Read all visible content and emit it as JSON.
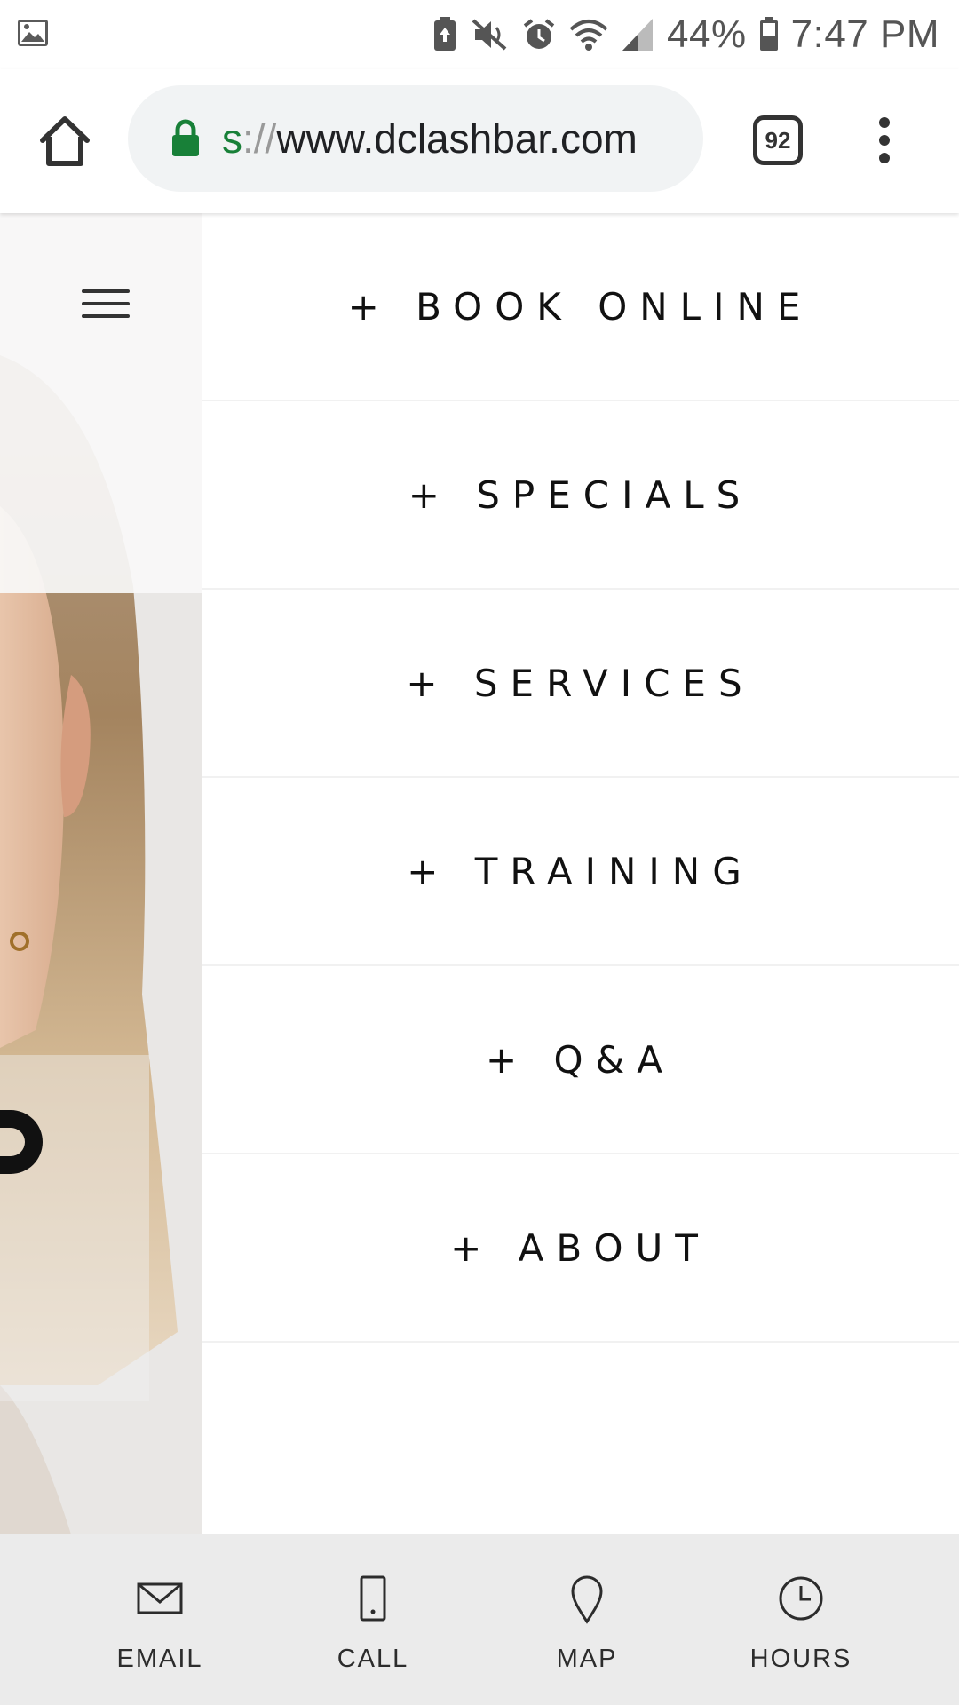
{
  "status_bar": {
    "battery_percent": "44%",
    "time": "7:47 PM",
    "icons": [
      "gallery-icon",
      "battery-saver-icon",
      "vibrate-mute-icon",
      "alarm-icon",
      "wifi-icon",
      "signal-icon",
      "battery-icon"
    ]
  },
  "browser": {
    "url_scheme": "s",
    "url_separator": "://",
    "url_host": "www.dclashbar.com",
    "tab_count": "92",
    "lock_color": "#188038"
  },
  "nav": {
    "items": [
      {
        "label": "+ BOOK ONLINE"
      },
      {
        "label": "+ SPECIALS"
      },
      {
        "label": "+ SERVICES"
      },
      {
        "label": "+ TRAINING"
      },
      {
        "label": "+ Q&A"
      },
      {
        "label": "+ ABOUT"
      }
    ]
  },
  "bottom_bar": {
    "items": [
      {
        "label": "EMAIL",
        "icon": "envelope-icon"
      },
      {
        "label": "CALL",
        "icon": "phone-icon"
      },
      {
        "label": "MAP",
        "icon": "map-pin-icon"
      },
      {
        "label": "HOURS",
        "icon": "clock-icon"
      }
    ]
  }
}
